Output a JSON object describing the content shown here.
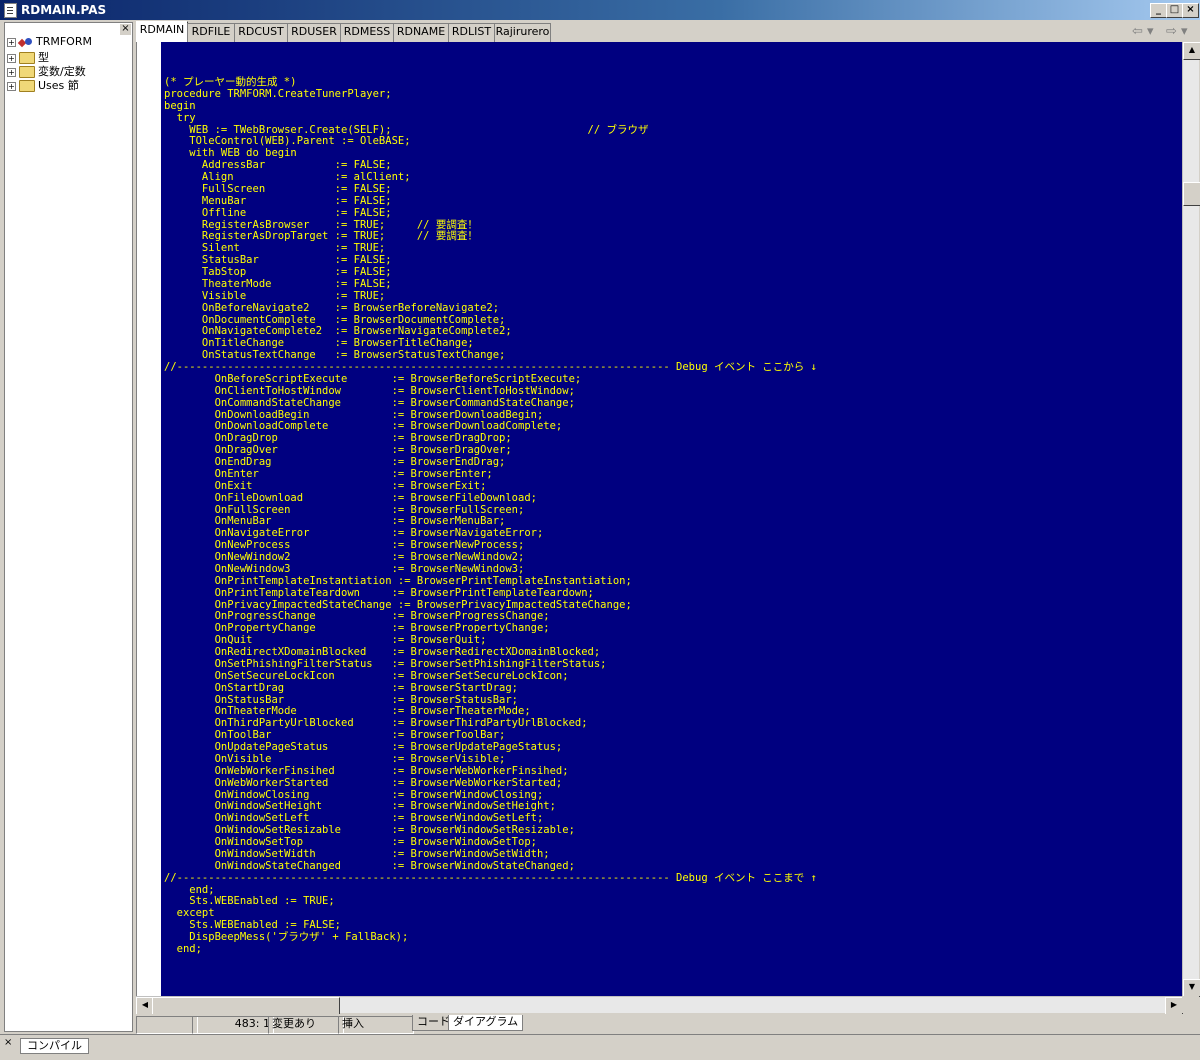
{
  "window": {
    "title": "RDMAIN.PAS",
    "buttons": [
      "_",
      "□",
      "×"
    ]
  },
  "tree": {
    "close_label": "×",
    "items": [
      {
        "label": "TRMFORM",
        "expander": "+",
        "icon": "form-icon"
      },
      {
        "label": "型",
        "expander": "+",
        "icon": "folder-icon"
      },
      {
        "label": "変数/定数",
        "expander": "+",
        "icon": "folder-icon"
      },
      {
        "label": "Uses 節",
        "expander": "+",
        "icon": "folder-icon"
      }
    ]
  },
  "tabs": [
    {
      "label": "RDMAIN",
      "active": true
    },
    {
      "label": "RDFILE"
    },
    {
      "label": "RDCUST"
    },
    {
      "label": "RDUSER"
    },
    {
      "label": "RDMESS"
    },
    {
      "label": "RDNAME"
    },
    {
      "label": "RDLIST"
    },
    {
      "label": "Rajirurero"
    }
  ],
  "nav": {
    "back": "⇦ ▾",
    "forward": "⇨ ▾"
  },
  "editor": {
    "colors": {
      "background": "#000080",
      "text": "#ffff00"
    },
    "code": "(* プレーヤー動的生成 *)\nprocedure TRMFORM.CreateTunerPlayer;\nbegin\n  try\n    WEB := TWebBrowser.Create(SELF);                               // ブラウザ\n    TOleControl(WEB).Parent := OleBASE;\n    with WEB do begin\n      AddressBar           := FALSE;\n      Align                := alClient;\n      FullScreen           := FALSE;\n      MenuBar              := FALSE;\n      Offline              := FALSE;\n      RegisterAsBrowser    := TRUE;     // 要調査！\n      RegisterAsDropTarget := TRUE;     // 要調査！\n      Silent               := TRUE;\n      StatusBar            := FALSE;\n      TabStop              := FALSE;\n      TheaterMode          := FALSE;\n      Visible              := TRUE;\n      OnBeforeNavigate2    := BrowserBeforeNavigate2;\n      OnDocumentComplete   := BrowserDocumentComplete;\n      OnNavigateComplete2  := BrowserNavigateComplete2;\n      OnTitleChange        := BrowserTitleChange;\n      OnStatusTextChange   := BrowserStatusTextChange;\n//------------------------------------------------------------------------------ Debug イベント ここから ↓\n        OnBeforeScriptExecute       := BrowserBeforeScriptExecute;\n        OnClientToHostWindow        := BrowserClientToHostWindow;\n        OnCommandStateChange        := BrowserCommandStateChange;\n        OnDownloadBegin             := BrowserDownloadBegin;\n        OnDownloadComplete          := BrowserDownloadComplete;\n        OnDragDrop                  := BrowserDragDrop;\n        OnDragOver                  := BrowserDragOver;\n        OnEndDrag                   := BrowserEndDrag;\n        OnEnter                     := BrowserEnter;\n        OnExit                      := BrowserExit;\n        OnFileDownload              := BrowserFileDownload;\n        OnFullScreen                := BrowserFullScreen;\n        OnMenuBar                   := BrowserMenuBar;\n        OnNavigateError             := BrowserNavigateError;\n        OnNewProcess                := BrowserNewProcess;\n        OnNewWindow2                := BrowserNewWindow2;\n        OnNewWindow3                := BrowserNewWindow3;\n        OnPrintTemplateInstantiation := BrowserPrintTemplateInstantiation;\n        OnPrintTemplateTeardown     := BrowserPrintTemplateTeardown;\n        OnPrivacyImpactedStateChange := BrowserPrivacyImpactedStateChange;\n        OnProgressChange            := BrowserProgressChange;\n        OnPropertyChange            := BrowserPropertyChange;\n        OnQuit                      := BrowserQuit;\n        OnRedirectXDomainBlocked    := BrowserRedirectXDomainBlocked;\n        OnSetPhishingFilterStatus   := BrowserSetPhishingFilterStatus;\n        OnSetSecureLockIcon         := BrowserSetSecureLockIcon;\n        OnStartDrag                 := BrowserStartDrag;\n        OnStatusBar                 := BrowserStatusBar;\n        OnTheaterMode               := BrowserTheaterMode;\n        OnThirdPartyUrlBlocked      := BrowserThirdPartyUrlBlocked;\n        OnToolBar                   := BrowserToolBar;\n        OnUpdatePageStatus          := BrowserUpdatePageStatus;\n        OnVisible                   := BrowserVisible;\n        OnWebWorkerFinsihed         := BrowserWebWorkerFinsihed;\n        OnWebWorkerStarted          := BrowserWebWorkerStarted;\n        OnWindowClosing             := BrowserWindowClosing;\n        OnWindowSetHeight           := BrowserWindowSetHeight;\n        OnWindowSetLeft             := BrowserWindowSetLeft;\n        OnWindowSetResizable        := BrowserWindowSetResizable;\n        OnWindowSetTop              := BrowserWindowSetTop;\n        OnWindowSetWidth            := BrowserWindowSetWidth;\n        OnWindowStateChanged        := BrowserWindowStateChanged;\n//------------------------------------------------------------------------------ Debug イベント ここまで ↑\n    end;\n    Sts.WEBEnabled := TRUE;\n  except\n    Sts.WEBEnabled := FALSE;\n    DispBeepMess('ブラウザ' + FallBack);\n  end;"
  },
  "statusbar": {
    "position": "483:  1",
    "modified": "変更あり",
    "mode": "挿入",
    "view_tabs": [
      "コード",
      "ダイアグラム"
    ]
  },
  "bottom": {
    "close_label": "×",
    "tab": "コンパイル"
  }
}
